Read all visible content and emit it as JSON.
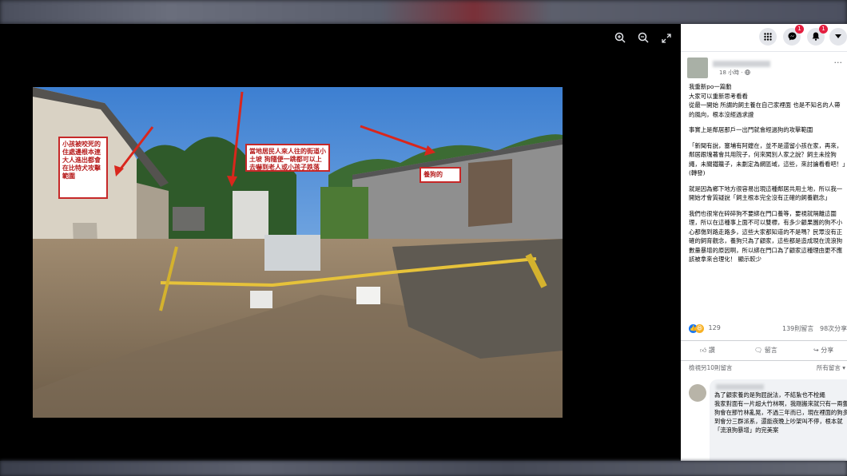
{
  "viewer": {
    "zoom_in_icon": "zoom-in-icon",
    "zoom_out_icon": "zoom-out-icon",
    "fullscreen_icon": "fullscreen-icon",
    "callouts": [
      "小孩被咬死的住處邊根本連大人進出都會在比特犬攻擊範圍",
      "當地居民人來人往的街道小土坡 狗隨便一跳都可以上去嚇到老人或小孩子跌落",
      "養狗的"
    ]
  },
  "topbar": {
    "menu_icon": "grid-icon",
    "messenger_icon": "messenger-icon",
    "messenger_badge": "1",
    "notifications_icon": "bell-icon",
    "notifications_badge": "1",
    "account_icon": "chevron-down-icon"
  },
  "post": {
    "time": "18 小時 · ",
    "more": "···",
    "paragraphs": [
      "我重新po一篇動\n大家可以重新思考看看\n從最一開始 所謂的飼主養在自己家裡面 也是不知名的人帶的風向，根本沒經過求證",
      "事實上是鄰居那戶一出門就會經過狗的攻擊範圍",
      "「新聞有說，塞埔有阿嬤在，並不是還留小孩在家，再來，鄰居跟塊著會共用院子，何來闖別人家之說？飼主未拴狗繩，未關鐵籠子，未劃定為網區域，這些，來討論看看吧！」(轉發)",
      "就是因為鄉下地方很容易出現這種鄰居共用土地，所以我一開始才會質疑說「飼主根本完全沒有正確的飼養觀念」",
      "我們也很常在碎碎狗不要綁在門口養等，要視就隔離這圍理，所以在這種事上面不可以雙標，有多少顧果園的狗不小心都傷到路走路多，這些大家都知道的不是嗎？民眾沒有正確的飼育觀念，養狗只為了顧家，這些都是造成現在流浪狗數量暴增的原因啊，所以綁在門口為了顧家這種理由更不應該被拿來合理化！ 顯示較少"
    ],
    "reaction_count": "129",
    "comments_count": "139則留言",
    "shares_count": "98次分享",
    "actions": [
      "讚",
      "留言",
      "分享"
    ],
    "more_comments": "檢視另10則留言",
    "all_comments": "所有留言 ▾",
    "comment_lines": [
      "為了顧家養的是狗屁說法，不結紮也不栓繩",
      "我家對面有一片超大竹林啊，我剛搬來就只有一兩隻狗會在那竹林亂晃，不過三年而已，現在裡面的狗多到會分三群派系，還能夜晚上吵架叫不停，根本就「流浪狗暴增」的完美案"
    ]
  },
  "colors": {
    "badge": "#e41e3f",
    "like": "#1877f2",
    "haha": "#f7b125",
    "callout_border": "#c62828"
  }
}
